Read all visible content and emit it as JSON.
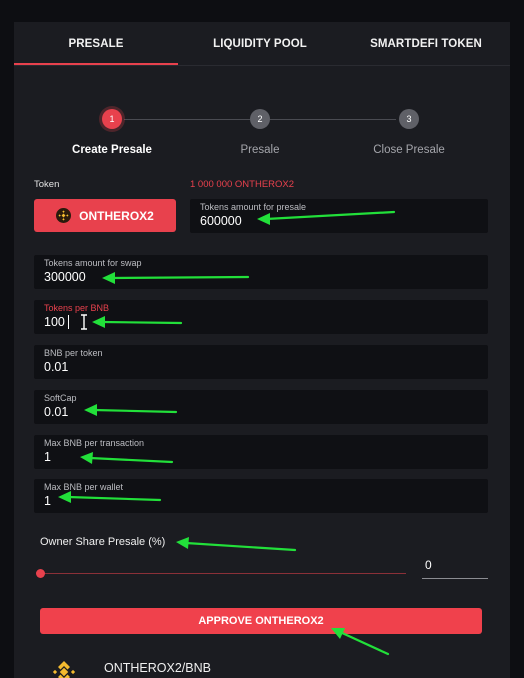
{
  "tabs": [
    {
      "label": "PRESALE",
      "active": true
    },
    {
      "label": "LIQUIDITY POOL",
      "active": false
    },
    {
      "label": "SMARTDEFI TOKEN",
      "active": false
    }
  ],
  "steps": [
    {
      "number": "1",
      "label": "Create Presale",
      "active": true
    },
    {
      "number": "2",
      "label": "Presale",
      "active": false
    },
    {
      "number": "3",
      "label": "Close Presale",
      "active": false
    }
  ],
  "token": {
    "label": "Token",
    "balance": "1 000 000 ONTHEROX2",
    "name": "ONTHEROX2",
    "icon": "bnb-icon"
  },
  "fields": {
    "tokens_presale": {
      "label": "Tokens amount for presale",
      "value": "600000"
    },
    "tokens_swap": {
      "label": "Tokens amount for swap",
      "value": "300000"
    },
    "tokens_per_bnb": {
      "label": "Tokens per BNB",
      "value": "100"
    },
    "bnb_per_token": {
      "label": "BNB per token",
      "value": "0.01"
    },
    "softcap": {
      "label": "SoftCap",
      "value": "0.01"
    },
    "max_per_tx": {
      "label": "Max BNB per transaction",
      "value": "1"
    },
    "max_per_wallet": {
      "label": "Max BNB per wallet",
      "value": "1"
    }
  },
  "owner_share": {
    "label": "Owner Share Presale (%)",
    "value": "0",
    "slider_fraction": 0
  },
  "approve": {
    "label": "APPROVE ONTHEROX2"
  },
  "pair": {
    "label": "ONTHEROX2/BNB",
    "icon": "bnb-icon"
  },
  "colors": {
    "accent": "#e8414d",
    "panel": "#1b1c21",
    "field": "#0f1014",
    "annotation_arrow": "#22e03a"
  }
}
